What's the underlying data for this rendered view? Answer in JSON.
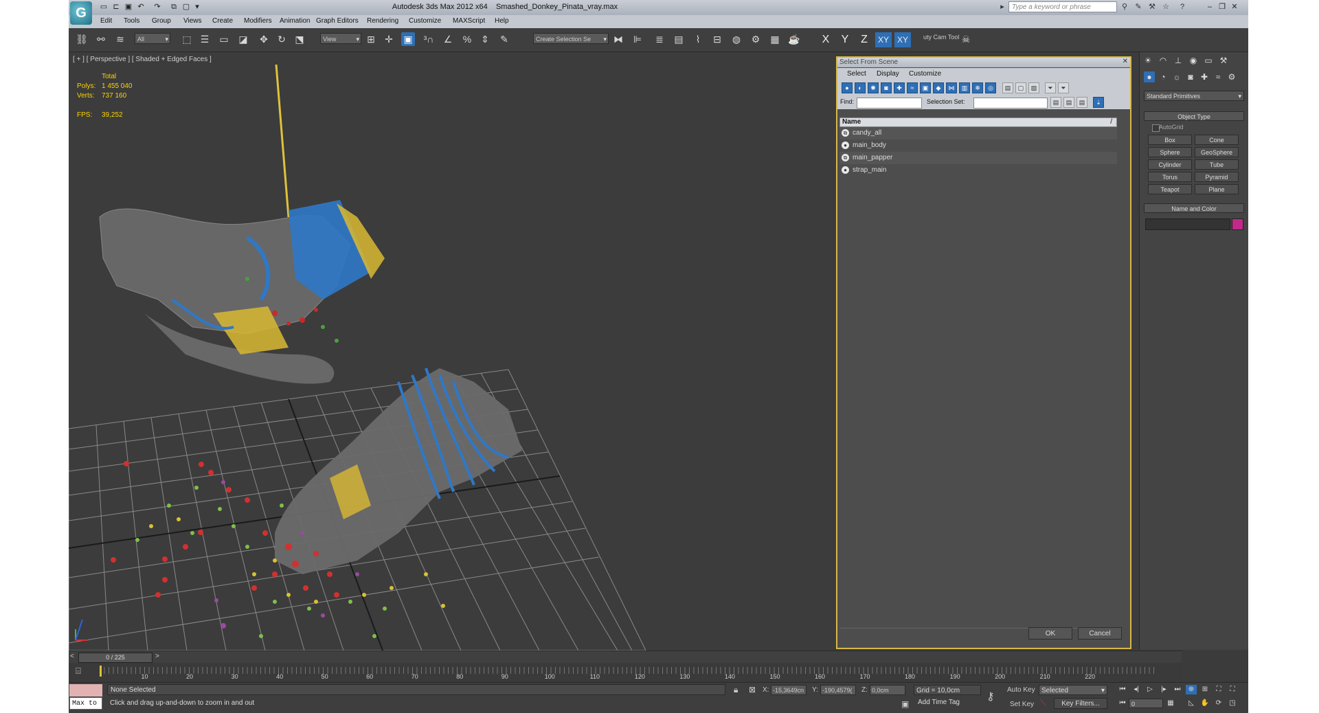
{
  "app": {
    "title": "Autodesk 3ds Max  2012 x64",
    "file": "Smashed_Donkey_Pinata_vray.max",
    "search_placeholder": "Type a keyword or phrase",
    "logo_letter": "G"
  },
  "menu": [
    "Edit",
    "Tools",
    "Group",
    "Views",
    "Create",
    "Modifiers",
    "Animation",
    "Graph Editors",
    "Rendering",
    "Customize",
    "MAXScript",
    "Help"
  ],
  "toolbar": {
    "filter_value": "All",
    "ref_coord_value": "View",
    "selection_set_placeholder": "Create Selection Se",
    "axes": [
      "X",
      "Y",
      "Z",
      "XY",
      "XY"
    ],
    "cam_tool_label": "uty Cam Tool"
  },
  "viewport": {
    "label": "[ + ] [ Perspective ] [ Shaded + Edged Faces ]",
    "stats": {
      "total_label": "Total",
      "polys_label": "Polys:",
      "polys_value": "1 455 040",
      "verts_label": "Verts:",
      "verts_value": "737 160",
      "fps_label": "FPS:",
      "fps_value": "39,252"
    }
  },
  "dialog": {
    "title": "Select From Scene",
    "menu": [
      "Select",
      "Display",
      "Customize"
    ],
    "find_label": "Find:",
    "selection_set_label": "Selection Set:",
    "column_header": "Name",
    "sort_indicator": "/",
    "items": [
      {
        "name": "candy_all",
        "icon": "group-icon"
      },
      {
        "name": "main_body",
        "icon": "geometry-icon"
      },
      {
        "name": "main_papper",
        "icon": "group-icon"
      },
      {
        "name": "strap_main",
        "icon": "geometry-icon"
      }
    ],
    "ok_label": "OK",
    "cancel_label": "Cancel"
  },
  "command_panel": {
    "category": "Standard Primitives",
    "object_type_title": "Object Type",
    "autogrid_label": "AutoGrid",
    "primitives": [
      "Box",
      "Cone",
      "Sphere",
      "GeoSphere",
      "Cylinder",
      "Tube",
      "Torus",
      "Pyramid",
      "Teapot",
      "Plane"
    ],
    "name_color_title": "Name and Color",
    "object_color": "#c22a89"
  },
  "timeline": {
    "frame_display": "0 / 225",
    "ticks": [
      "10",
      "20",
      "30",
      "40",
      "50",
      "60",
      "70",
      "80",
      "90",
      "100",
      "110",
      "120",
      "130",
      "140",
      "150",
      "160",
      "170",
      "180",
      "190",
      "200",
      "210",
      "220"
    ]
  },
  "status": {
    "maxscript": "Max to",
    "selection": "None Selected",
    "prompt": "Click and drag up-and-down to zoom in and out",
    "x_label": "X:",
    "x_value": "-15,3649cn",
    "y_label": "Y:",
    "y_value": "-190,4579(",
    "z_label": "Z:",
    "z_value": "0,0cm",
    "grid": "Grid = 10,0cm",
    "add_time_tag": "Add Time Tag",
    "auto_key": "Auto Key",
    "set_key": "Set Key",
    "selected": "Selected",
    "key_filters": "Key Filters...",
    "frame": "0"
  }
}
